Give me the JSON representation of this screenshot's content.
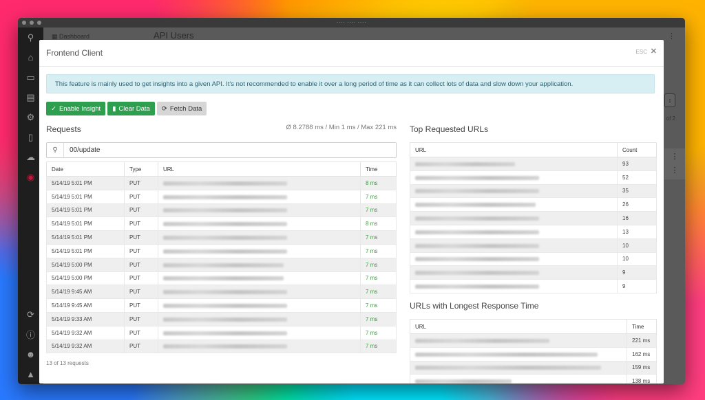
{
  "window": {
    "title": "···· ···· ····"
  },
  "background": {
    "breadcrumb": "Dashboard",
    "title": "API Users",
    "page_indicator": "of 2"
  },
  "modal": {
    "title": "Frontend Client",
    "esc_label": "ESC",
    "alert": "This feature is mainly used to get insights into a given API. It's not recommended to enable it over a long period of time as it can collect lots of data and slow down your application.",
    "buttons": {
      "enable": "Enable Insight",
      "clear": "Clear Data",
      "fetch": "Fetch Data"
    }
  },
  "requests": {
    "title": "Requests",
    "stats": "Ø 8.2788 ms / Min 1 ms / Max 221 ms",
    "search_value": "00/update",
    "columns": {
      "date": "Date",
      "type": "Type",
      "url": "URL",
      "time": "Time"
    },
    "rows": [
      {
        "date": "5/14/19 5:01 PM",
        "type": "PUT",
        "time": "8 ms"
      },
      {
        "date": "5/14/19 5:01 PM",
        "type": "PUT",
        "time": "7 ms"
      },
      {
        "date": "5/14/19 5:01 PM",
        "type": "PUT",
        "time": "7 ms"
      },
      {
        "date": "5/14/19 5:01 PM",
        "type": "PUT",
        "time": "8 ms"
      },
      {
        "date": "5/14/19 5:01 PM",
        "type": "PUT",
        "time": "7 ms"
      },
      {
        "date": "5/14/19 5:01 PM",
        "type": "PUT",
        "time": "7 ms"
      },
      {
        "date": "5/14/19 5:00 PM",
        "type": "PUT",
        "time": "7 ms"
      },
      {
        "date": "5/14/19 5:00 PM",
        "type": "PUT",
        "time": "7 ms"
      },
      {
        "date": "5/14/19 9:45 AM",
        "type": "PUT",
        "time": "7 ms"
      },
      {
        "date": "5/14/19 9:45 AM",
        "type": "PUT",
        "time": "7 ms"
      },
      {
        "date": "5/14/19 9:33 AM",
        "type": "PUT",
        "time": "7 ms"
      },
      {
        "date": "5/14/19 9:32 AM",
        "type": "PUT",
        "time": "7 ms"
      },
      {
        "date": "5/14/19 9:32 AM",
        "type": "PUT",
        "time": "7 ms"
      }
    ],
    "footer": "13 of 13 requests"
  },
  "top_urls": {
    "title": "Top Requested URLs",
    "columns": {
      "url": "URL",
      "count": "Count"
    },
    "rows": [
      {
        "count": "93"
      },
      {
        "count": "52"
      },
      {
        "count": "35"
      },
      {
        "count": "26"
      },
      {
        "count": "16"
      },
      {
        "count": "13"
      },
      {
        "count": "10"
      },
      {
        "count": "10"
      },
      {
        "count": "9"
      },
      {
        "count": "9"
      }
    ]
  },
  "longest": {
    "title": "URLs with Longest Response Time",
    "columns": {
      "url": "URL",
      "time": "Time"
    },
    "rows": [
      {
        "time": "221 ms"
      },
      {
        "time": "162 ms"
      },
      {
        "time": "159 ms"
      },
      {
        "time": "138 ms"
      }
    ]
  },
  "colors": {
    "accent_green": "#2e9e4f",
    "alert_bg": "#d7eef3",
    "time_green": "#3a9a3a"
  }
}
